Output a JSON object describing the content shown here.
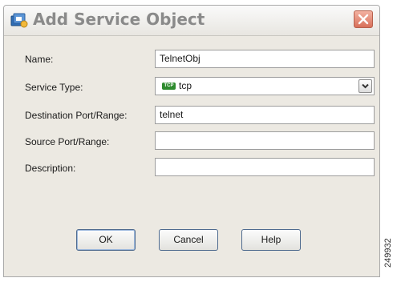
{
  "dialog": {
    "title": "Add Service Object",
    "icons": {
      "title_icon": "service-object-icon",
      "close_icon": "close-icon",
      "dropdown_icon": "chevron-down-icon",
      "protocol_icon": "tcp-badge-icon"
    },
    "fields": {
      "name": {
        "label": "Name:",
        "value": "TelnetObj"
      },
      "service_type": {
        "label": "Service Type:",
        "value": "tcp",
        "badge": "TCP"
      },
      "destination_port": {
        "label": "Destination Port/Range:",
        "value": "telnet"
      },
      "source_port": {
        "label": "Source Port/Range:",
        "value": ""
      },
      "description": {
        "label": "Description:",
        "value": ""
      }
    },
    "buttons": {
      "ok": "OK",
      "cancel": "Cancel",
      "help": "Help"
    }
  },
  "figure_id": "249932",
  "colors": {
    "dialog_bg": "#ece9e2",
    "close_button": "#d8705a",
    "tcp_badge": "#2e8b2e",
    "button_border": "#4f6b8f"
  }
}
